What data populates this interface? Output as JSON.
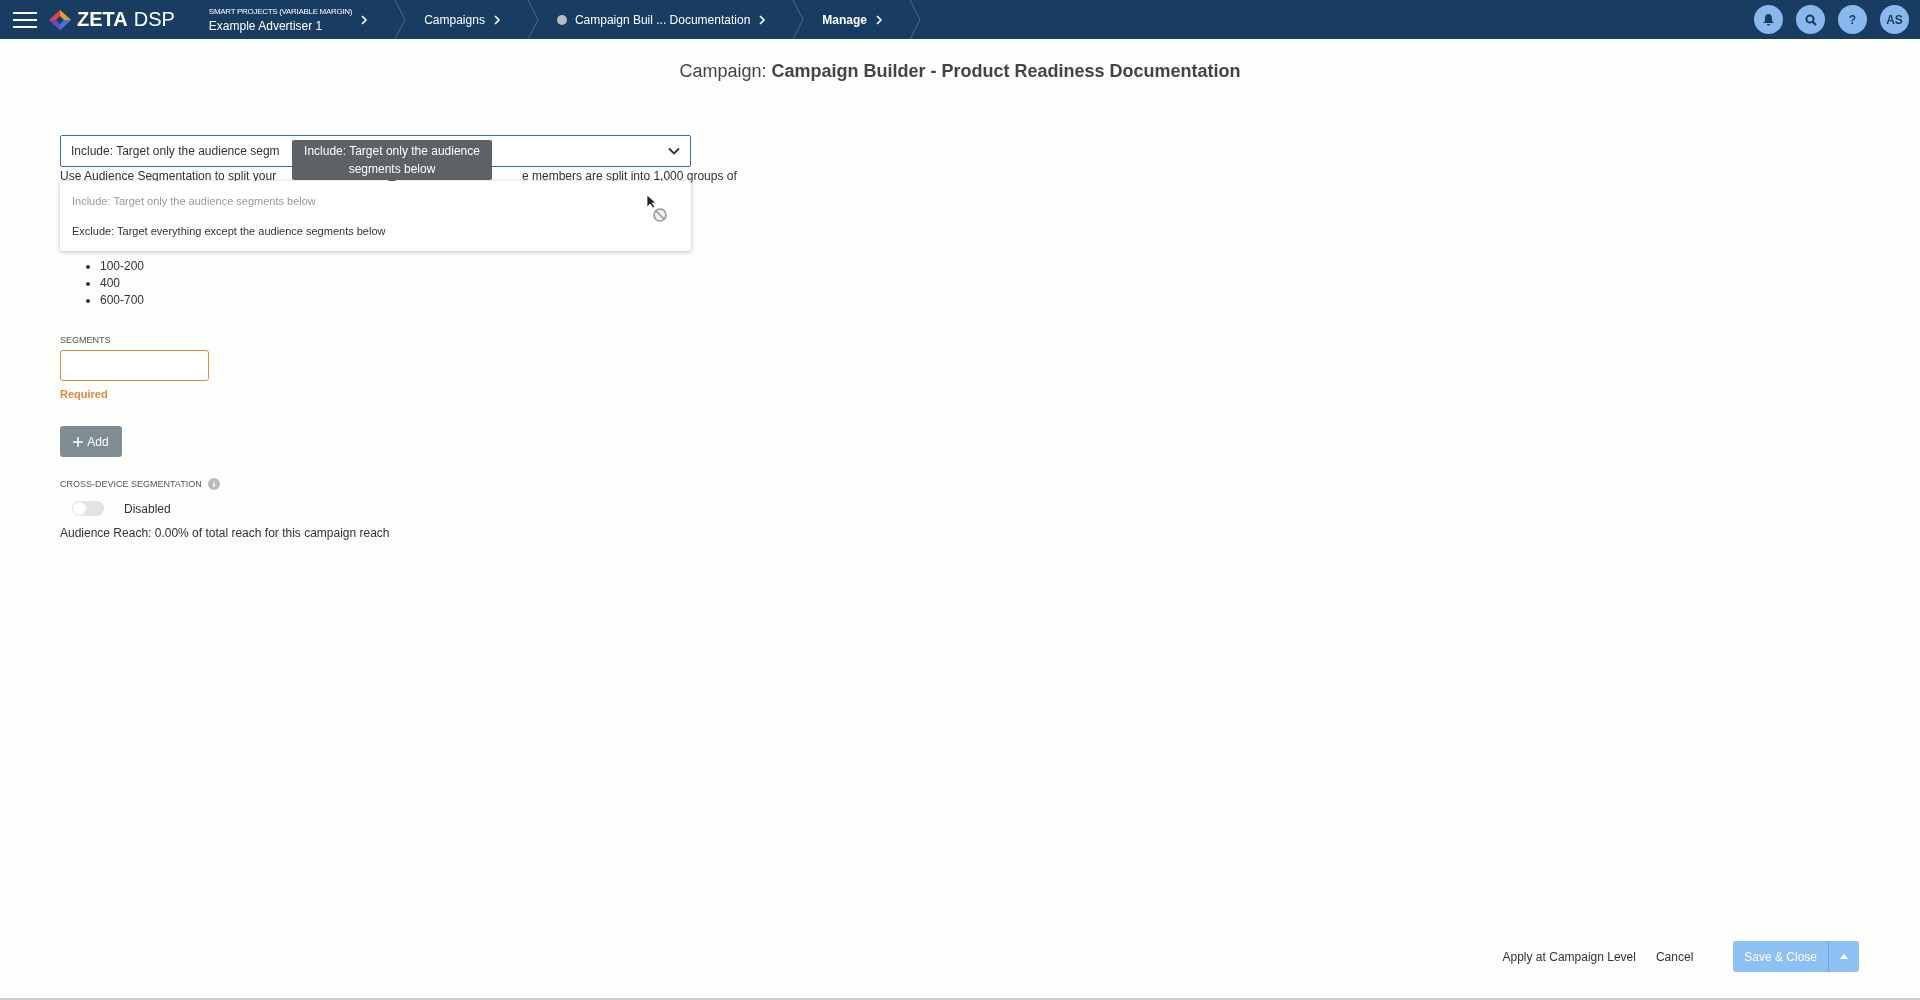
{
  "header": {
    "logo": {
      "brand": "ZETA",
      "product": "DSP"
    },
    "breadcrumbs": [
      {
        "kind": "account",
        "caption": "SMART PROJECTS (VARIABLE MARGIN)",
        "label": "Example Advertiser 1"
      },
      {
        "kind": "link",
        "label": "Campaigns"
      },
      {
        "kind": "status",
        "label": "Campaign Buil ... Documentation"
      },
      {
        "kind": "current",
        "label": "Manage"
      }
    ],
    "actions": [
      {
        "kind": "bell"
      },
      {
        "kind": "search"
      },
      {
        "kind": "help",
        "label": "?"
      },
      {
        "kind": "avatar",
        "label": "AS"
      }
    ]
  },
  "title": {
    "prefix": "Campaign:",
    "name": "Campaign Builder - Product Readiness Documentation"
  },
  "targeting_select": {
    "value": "Include: Target only the audience segm",
    "expanded": true,
    "tooltip": "Include: Target only the audience segments below",
    "options": [
      {
        "label": "Include: Target only the audience segments below",
        "selected": true
      },
      {
        "label": "Exclude: Target everything except the audience segments below",
        "selected": false
      }
    ]
  },
  "description": [
    "Use Audience Segmentation to split your",
    "e members are split into 1,000 groups of"
  ],
  "segment_ranges": [
    "100-200",
    "400",
    "600-700"
  ],
  "segments_field": {
    "label": "SEGMENTS",
    "error": "Required"
  },
  "add_button": "Add",
  "cross_device": {
    "label": "CROSS-DEVICE SEGMENTATION",
    "on": false,
    "status": "Disabled"
  },
  "audience_reach": "Audience Reach: 0.00% of total reach for this campaign reach",
  "footer": {
    "apply": "Apply at Campaign Level",
    "cancel": "Cancel",
    "save": "Save & Close",
    "save_disabled": true
  }
}
